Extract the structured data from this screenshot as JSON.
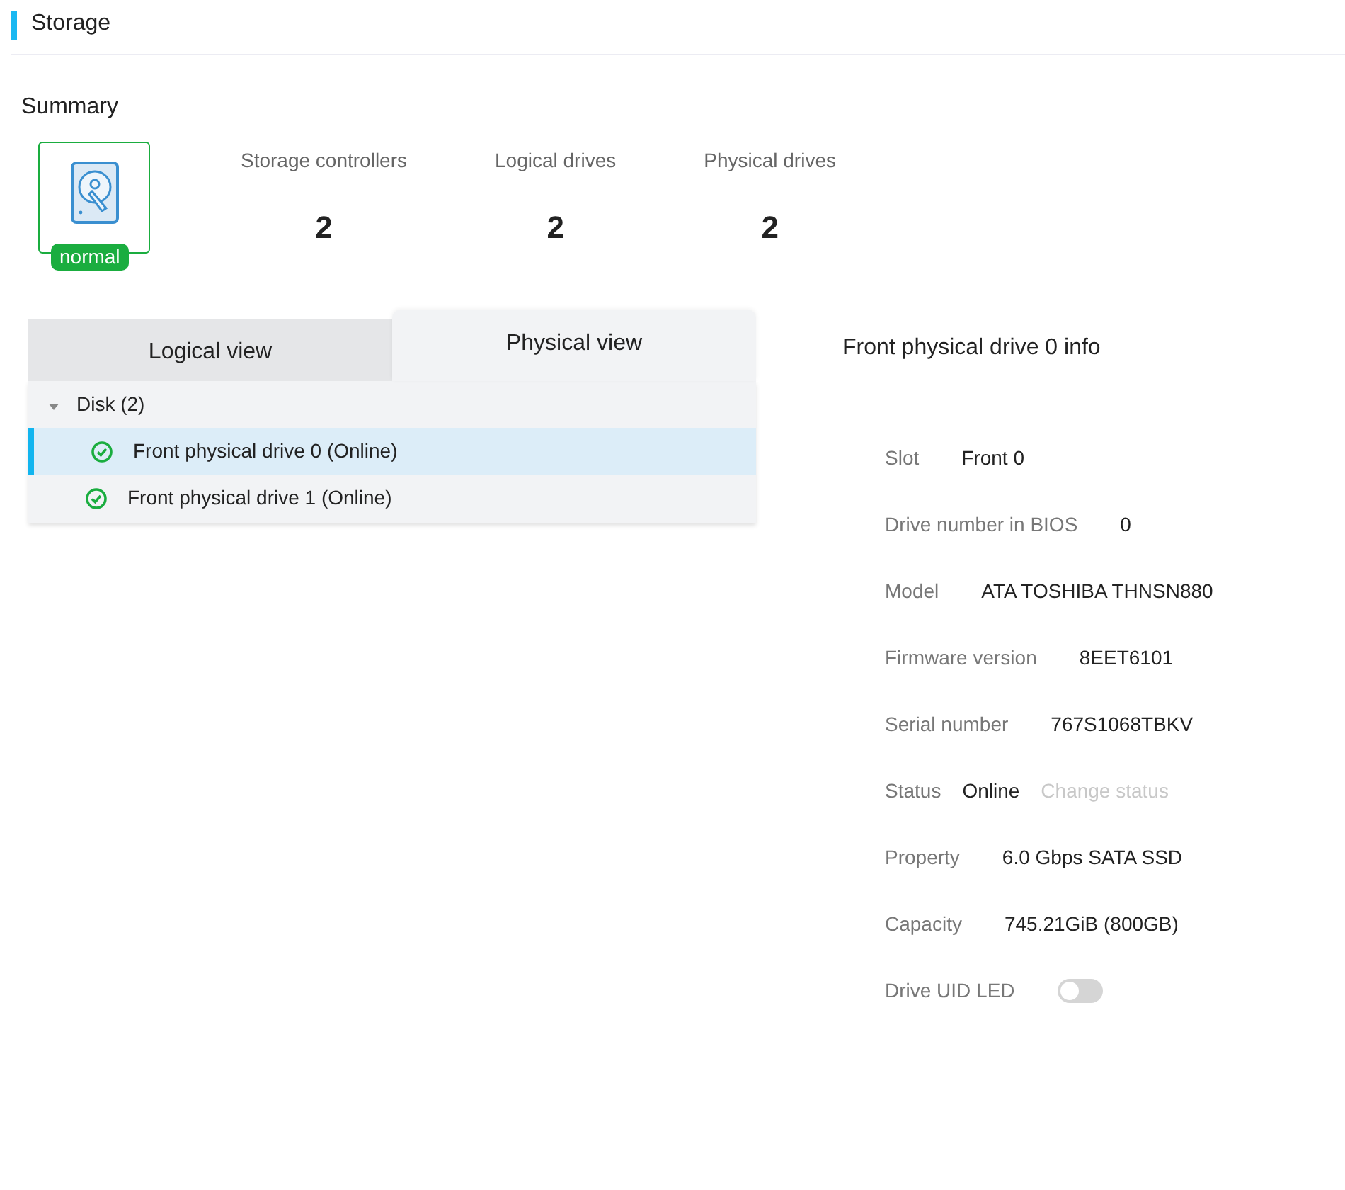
{
  "page_title": "Storage",
  "summary": {
    "title": "Summary",
    "health": {
      "label": "normal",
      "color": "#1aad3f"
    },
    "stats": [
      {
        "label": "Storage controllers",
        "value": "2"
      },
      {
        "label": "Logical drives",
        "value": "2"
      },
      {
        "label": "Physical drives",
        "value": "2"
      }
    ]
  },
  "tabs": [
    {
      "label": "Logical view",
      "selected": false
    },
    {
      "label": "Physical view",
      "selected": true
    }
  ],
  "tree": [
    {
      "label": "Disk (2)",
      "expanded": true,
      "children": [
        {
          "label": "Front physical drive 0 (Online)",
          "selected": true
        },
        {
          "label": "Front physical drive 1 (Online)",
          "selected": false
        }
      ]
    }
  ],
  "details": {
    "title": "Front physical drive 0 info",
    "fields": [
      {
        "kind": "text",
        "label": "Slot",
        "value": "Front 0"
      },
      {
        "kind": "text",
        "label": "Drive number in BIOS",
        "value": "0"
      },
      {
        "kind": "text",
        "label": "Model",
        "value": "ATA TOSHIBA THNSN880"
      },
      {
        "kind": "text",
        "label": "Firmware version",
        "value": "8EET6101"
      },
      {
        "kind": "text",
        "label": "Serial number",
        "value": "767S1068TBKV"
      },
      {
        "kind": "status",
        "label": "Status",
        "value": "Online",
        "action": {
          "label": "Change status",
          "disabled": true
        }
      },
      {
        "kind": "text",
        "label": "Property",
        "value": "6.0 Gbps SATA SSD"
      },
      {
        "kind": "text",
        "label": "Capacity",
        "value": "745.21GiB (800GB)"
      },
      {
        "kind": "toggle",
        "label": "Drive UID LED",
        "on": false
      }
    ]
  }
}
